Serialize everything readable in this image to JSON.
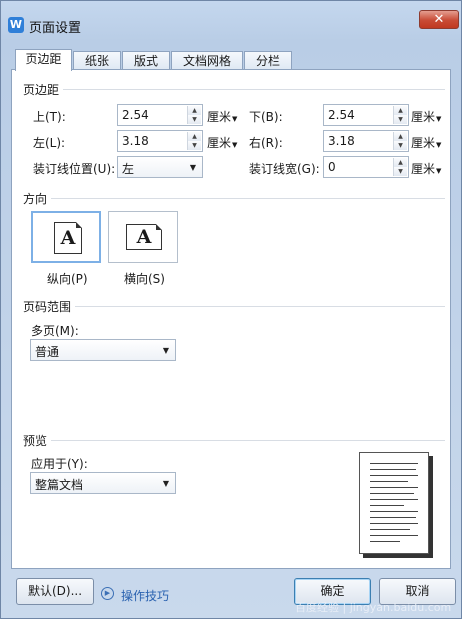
{
  "window": {
    "title": "页面设置",
    "close_glyph": "✕"
  },
  "tabs": [
    "页边距",
    "纸张",
    "版式",
    "文档网格",
    "分栏"
  ],
  "margins": {
    "section_title": "页边距",
    "top": {
      "label": "上(T):",
      "value": "2.54",
      "unit": "厘米"
    },
    "bottom": {
      "label": "下(B):",
      "value": "2.54",
      "unit": "厘米"
    },
    "left": {
      "label": "左(L):",
      "value": "3.18",
      "unit": "厘米"
    },
    "right": {
      "label": "右(R):",
      "value": "3.18",
      "unit": "厘米"
    },
    "gutter_position": {
      "label": "装订线位置(U):",
      "value": "左"
    },
    "gutter_width": {
      "label": "装订线宽(G):",
      "value": "0",
      "unit": "厘米"
    }
  },
  "orientation": {
    "section_title": "方向",
    "portrait": {
      "label": "纵向(P)",
      "glyph": "A",
      "selected": true
    },
    "landscape": {
      "label": "横向(S)",
      "glyph": "A",
      "selected": false
    }
  },
  "pages": {
    "section_title": "页码范围",
    "multi_label": "多页(M):",
    "multi_value": "普通"
  },
  "preview": {
    "section_title": "预览",
    "apply_label": "应用于(Y):",
    "apply_value": "整篇文档"
  },
  "footer": {
    "default_button": "默认(D)...",
    "tips_link": "操作技巧",
    "ok_button": "确定",
    "cancel_button": "取消",
    "watermark": "百度经验 | jingyan.baidu.com"
  }
}
